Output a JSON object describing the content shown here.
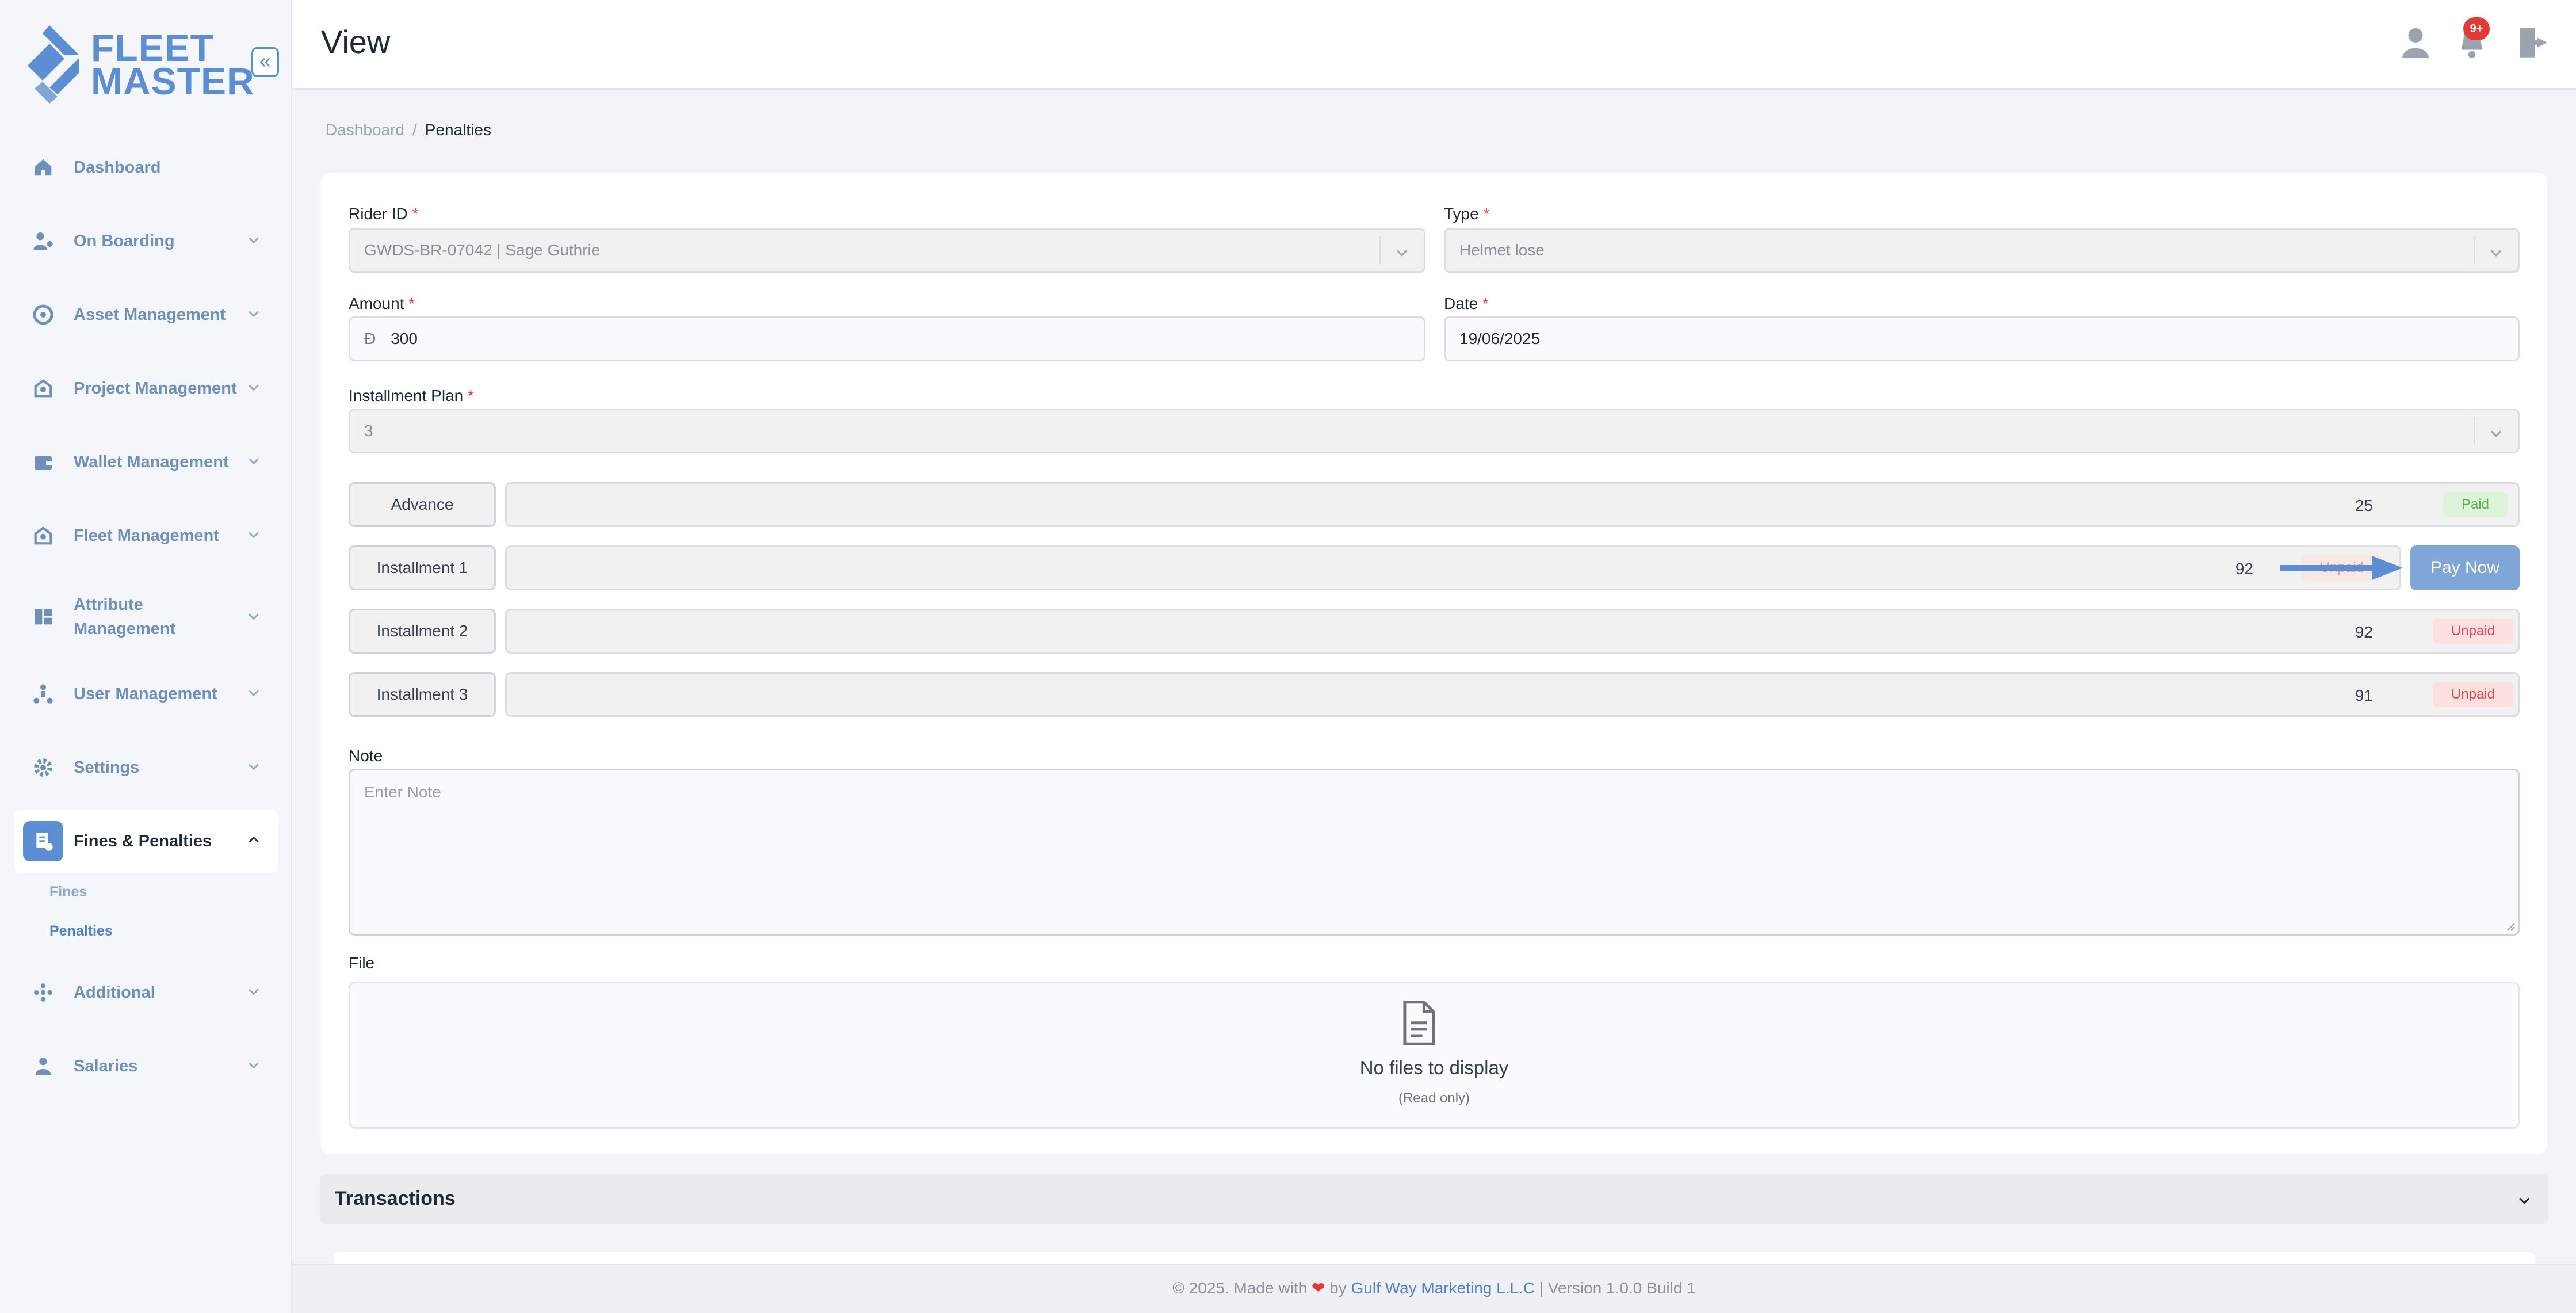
{
  "brand": {
    "line1": "FLEET",
    "line2": "MASTER"
  },
  "header": {
    "title": "View",
    "notification_count": "9+"
  },
  "sidebar": {
    "items": [
      {
        "label": "Dashboard",
        "icon": "home-icon"
      },
      {
        "label": "On Boarding",
        "icon": "onboarding-icon"
      },
      {
        "label": "Asset Management",
        "icon": "asset-icon"
      },
      {
        "label": "Project Management",
        "icon": "project-icon"
      },
      {
        "label": "Wallet Management",
        "icon": "wallet-icon"
      },
      {
        "label": "Fleet Management",
        "icon": "fleet-icon"
      },
      {
        "label": "Attribute",
        "label2": "Management",
        "icon": "attribute-icon"
      },
      {
        "label": "User Management",
        "icon": "users-icon"
      },
      {
        "label": "Settings",
        "icon": "gear-icon"
      },
      {
        "label": "Fines & Penalties",
        "icon": "fines-icon"
      },
      {
        "label": "Additional",
        "icon": "additional-icon"
      },
      {
        "label": "Salaries",
        "icon": "salaries-icon"
      }
    ],
    "subitems": [
      {
        "label": "Fines"
      },
      {
        "label": "Penalties"
      }
    ]
  },
  "breadcrumb": {
    "root": "Dashboard",
    "sep": "/",
    "current": "Penalties"
  },
  "form": {
    "rider_label": "Rider ID",
    "rider_value": "GWDS-BR-07042 | Sage Guthrie",
    "type_label": "Type",
    "type_value": "Helmet lose",
    "amount_label": "Amount",
    "amount_currency": "Đ",
    "amount_value": "300",
    "date_label": "Date",
    "date_value": "19/06/2025",
    "plan_label": "Installment Plan",
    "plan_value": "3",
    "required_mark": "*",
    "installments": [
      {
        "label": "Advance",
        "amount": "25",
        "status": "Paid"
      },
      {
        "label": "Installment 1",
        "amount": "92",
        "status": "Unpaid"
      },
      {
        "label": "Installment 2",
        "amount": "92",
        "status": "Unpaid"
      },
      {
        "label": "Installment 3",
        "amount": "91",
        "status": "Unpaid"
      }
    ],
    "pay_now": "Pay Now",
    "note_label": "Note",
    "note_placeholder": "Enter Note",
    "file_label": "File",
    "file_empty": "No files to display",
    "file_readonly": "(Read only)"
  },
  "transactions": {
    "title": "Transactions"
  },
  "footer": {
    "prefix": "© 2025. Made with",
    "heart": "❤",
    "by": "by",
    "company": "Gulf Way Marketing L.L.C",
    "version": "| Version 1.0.0 Build 1"
  },
  "colors": {
    "accent": "#5b8ed3",
    "paid": "#5ab25c",
    "unpaid": "#e0474c",
    "danger": "#e53935"
  }
}
